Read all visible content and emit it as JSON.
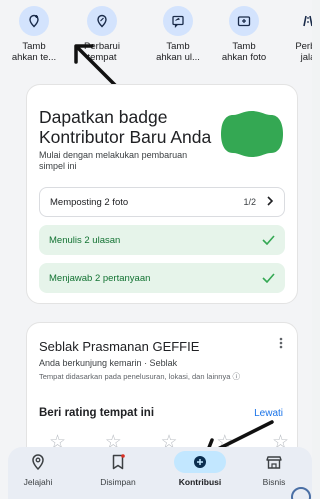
{
  "quick_actions": [
    {
      "label": "Tamb\nahkan te...",
      "icon": "place-add-icon"
    },
    {
      "label": "Perbarui\ntempat",
      "icon": "edit-place-icon"
    },
    {
      "label": "Tamb\nahkan ul...",
      "icon": "review-icon"
    },
    {
      "label": "Tamb\nahkan foto",
      "icon": "add-photo-icon"
    },
    {
      "label": "Perba\njala",
      "icon": "road-icon"
    }
  ],
  "badge_card": {
    "title": "Dapatkan badge Kontributor Baru Anda",
    "subtitle": "Mulai dengan melakukan pembaruan simpel ini",
    "tasks": [
      {
        "label": "Memposting 2 foto",
        "progress": "1/2"
      },
      {
        "label": "Menulis 2 ulasan"
      },
      {
        "label": "Menjawab 2 pertanyaan"
      }
    ]
  },
  "place_card": {
    "name": "Seblak Prasmanan GEFFIE",
    "visited": "Anda berkunjung kemarin · Seblak",
    "based_on": "Tempat didasarkan pada penelusuran, lokasi, dan lainnya ⓘ",
    "rate_prompt": "Beri rating tempat ini",
    "skip_label": "Lewati",
    "star_count": 5
  },
  "bottom_nav": [
    {
      "label": "Jelajahi",
      "icon": "explore-pin-icon"
    },
    {
      "label": "Disimpan",
      "icon": "bookmark-icon"
    },
    {
      "label": "Kontribusi",
      "icon": "add-circle-icon",
      "active": true
    },
    {
      "label": "Bisnis",
      "icon": "store-icon"
    }
  ],
  "colors": {
    "accent": "#1a73e8",
    "success": "#34a853",
    "badge_green": "#34a853",
    "active_pill": "#c2e7ff"
  }
}
